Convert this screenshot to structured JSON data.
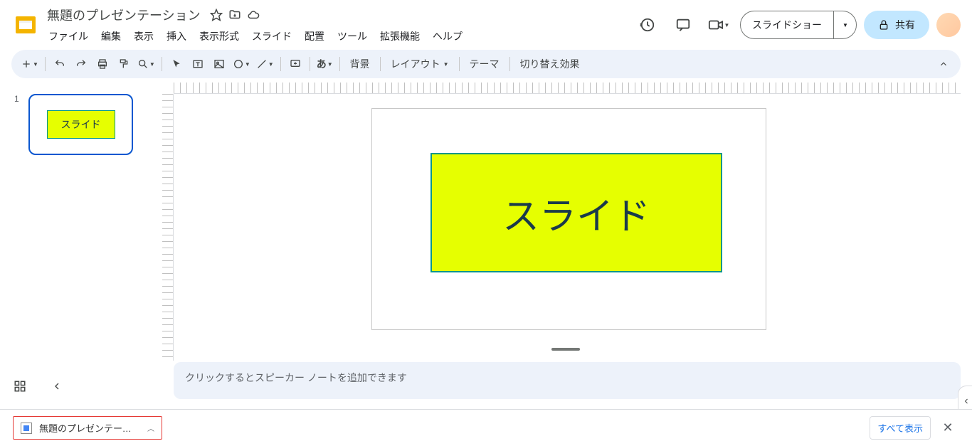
{
  "doc": {
    "title": "無題のプレゼンテーション"
  },
  "menus": [
    "ファイル",
    "編集",
    "表示",
    "挿入",
    "表示形式",
    "スライド",
    "配置",
    "ツール",
    "拡張機能",
    "ヘルプ"
  ],
  "header": {
    "slideshow": "スライドショー",
    "share": "共有"
  },
  "toolbar": {
    "spellcheck": "あ",
    "background": "背景",
    "layout": "レイアウト",
    "theme": "テーマ",
    "transition": "切り替え効果"
  },
  "filmstrip": {
    "slide_number": "1",
    "thumb_text": "スライド"
  },
  "canvas": {
    "shape_text": "スライド"
  },
  "notes": {
    "placeholder": "クリックするとスピーカー ノートを追加できます"
  },
  "download": {
    "filename": "無題のプレゼンテーシ....jpg",
    "show_all": "すべて表示"
  }
}
